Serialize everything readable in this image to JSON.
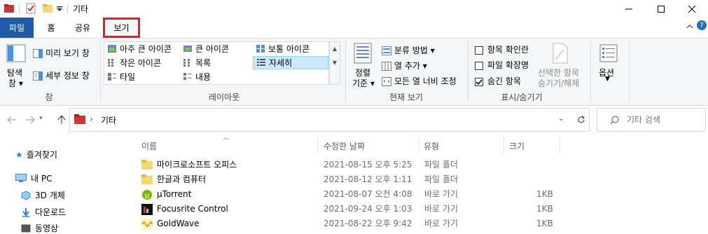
{
  "window": {
    "title": "기타",
    "minimize_label": "—",
    "maximize_label": "□",
    "close_label": "✕"
  },
  "tabs": [
    {
      "label": "파일"
    },
    {
      "label": "홈"
    },
    {
      "label": "공유"
    },
    {
      "label": "보기"
    }
  ],
  "ribbon": {
    "pane_group": {
      "nav_pane": "탐색",
      "nav_pane2": "창",
      "preview": "미리 보기 창",
      "details": "세부 정보 창",
      "label": "창"
    },
    "layout_group": {
      "items": [
        {
          "label": "아주 큰 아이콘"
        },
        {
          "label": "큰 아이콘"
        },
        {
          "label": "보통 아이콘"
        },
        {
          "label": "작은 아이콘"
        },
        {
          "label": "목록"
        },
        {
          "label": "자세히"
        },
        {
          "label": "타일"
        },
        {
          "label": "내용"
        }
      ],
      "label": "레이아웃"
    },
    "current_view_group": {
      "sort_line1": "정렬",
      "sort_line2": "기준",
      "group_by": "분류 방법",
      "add_column": "열 추가",
      "fit_columns": "모든 열 너비 조정",
      "label": "현재 보기"
    },
    "show_hide_group": {
      "item_checkbox": "항목 확인란",
      "file_ext": "파일 확장명",
      "hidden_items": "숨긴 항목",
      "hide_selected_line1": "선택한 항목",
      "hide_selected_line2": "숨기기/해제",
      "label": "표시/숨기기",
      "item_checkbox_checked": false,
      "file_ext_checked": false,
      "hidden_items_checked": true
    },
    "options": {
      "label": "옵션"
    }
  },
  "address": {
    "path": "기타",
    "separator": "›"
  },
  "search": {
    "placeholder": "기타 검색"
  },
  "nav_pane_items": [
    {
      "label": "즐겨찾기"
    },
    {
      "label": "내 PC"
    },
    {
      "label": "3D 개체"
    },
    {
      "label": "다운로드"
    },
    {
      "label": "동영상"
    }
  ],
  "columns": {
    "name": "이름",
    "modified": "수정한 날짜",
    "type": "유형",
    "size": "크기"
  },
  "files": [
    {
      "name": "마이크로소프트 오피스",
      "modified": "2021-08-15 오후 5:25",
      "type": "파일 폴더",
      "size": "",
      "icon": "folder-icon"
    },
    {
      "name": "한글과 컴퓨터",
      "modified": "2021-08-12 오후 1:11",
      "type": "파일 폴더",
      "size": "",
      "icon": "folder-icon"
    },
    {
      "name": "µTorrent",
      "modified": "2021-08-07 오전 4:08",
      "type": "바로 가기",
      "size": "1KB",
      "icon": "utorrent-icon"
    },
    {
      "name": "Focusrite Control",
      "modified": "2021-09-24 오후 1:03",
      "type": "바로 가기",
      "size": "1KB",
      "icon": "focusrite-icon"
    },
    {
      "name": "GoldWave",
      "modified": "2021-08-22 오후 9:42",
      "type": "바로 가기",
      "size": "1KB",
      "icon": "goldwave-icon"
    }
  ],
  "colors": {
    "file_tab": "#1f5ba6",
    "highlight_border": "#e31e24",
    "folder": "#f8d775",
    "selected_layout": "#cce8ff"
  }
}
